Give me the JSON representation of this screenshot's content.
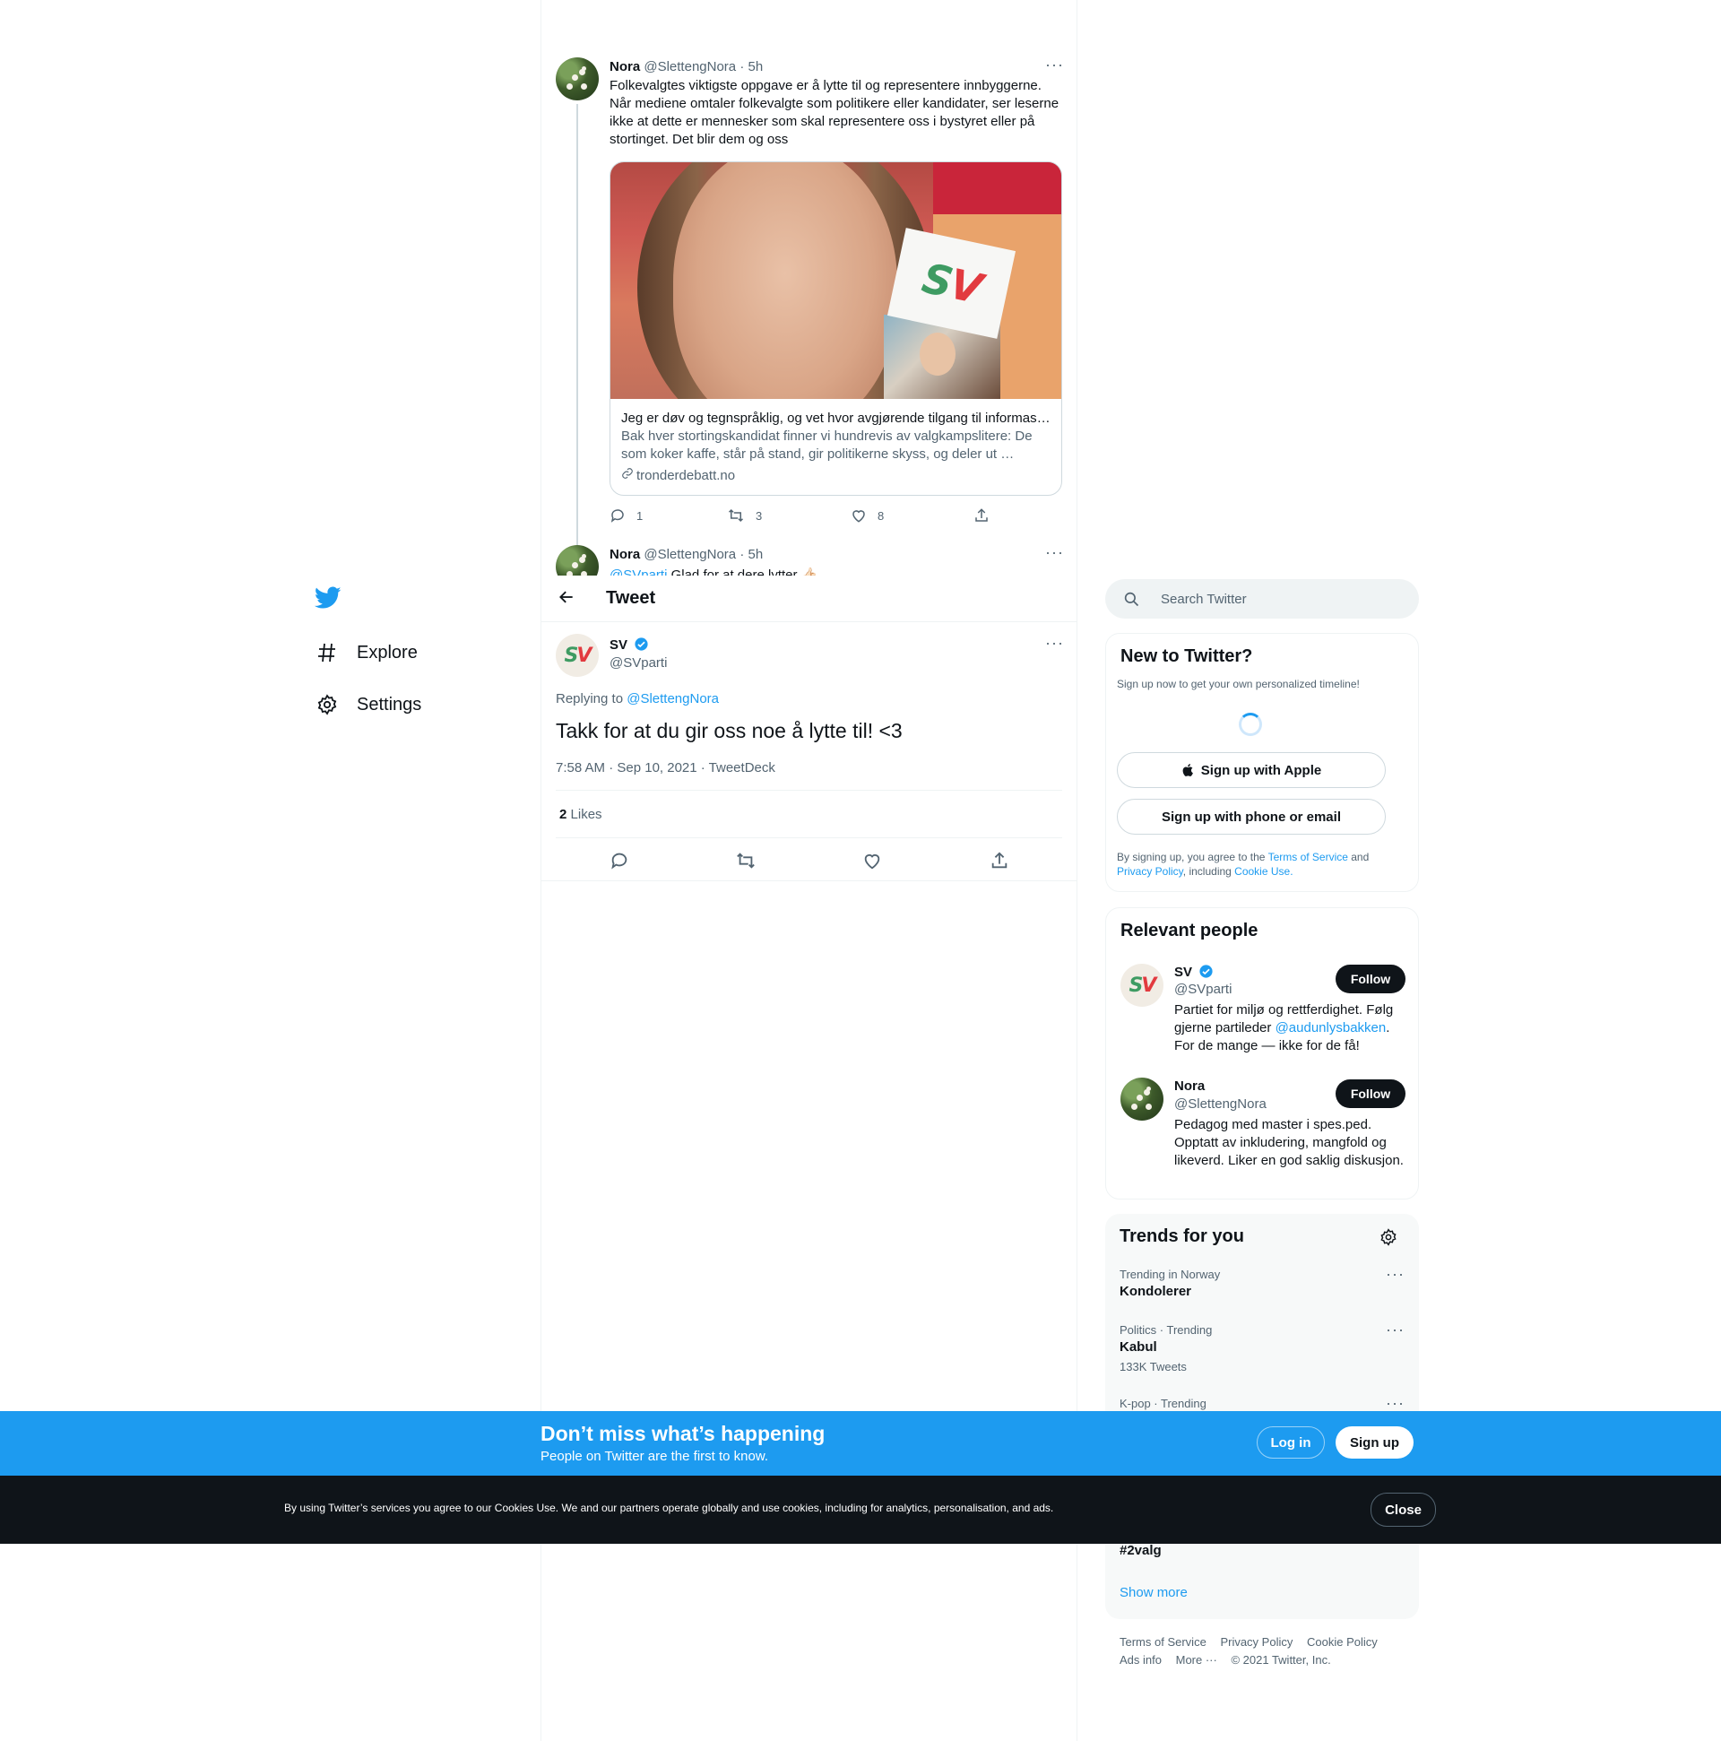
{
  "nav": {
    "explore": "Explore",
    "settings": "Settings"
  },
  "thread": {
    "tweet1": {
      "name": "Nora",
      "handle": "@SlettengNora",
      "sep": "·",
      "time": "5h",
      "text": "Folkevalgtes viktigste oppgave er å lytte til og representere innbyggerne. Når mediene omtaler folkevalgte som politikere eller kandidater, ser leserne ikke at dette er mennesker som skal representere oss i bystyret eller på stortinget. Det blir dem og oss",
      "card": {
        "image_text": "SV",
        "title": "Jeg er døv og tegnspråklig, og vet hvor avgjørende tilgang til informasj…",
        "description": "Bak hver stortingskandidat finner vi hundrevis av valgkampslitere: De som koker kaffe, står på stand, gir politikerne skyss, og deler ut …",
        "domain": "tronderdebatt.no"
      },
      "replies": "1",
      "retweets": "3",
      "likes": "8"
    },
    "tweet2": {
      "name": "Nora",
      "handle": "@SlettengNora",
      "sep": "·",
      "time": "5h",
      "mention": "@SVparti",
      "text": " Glad for at dere lytter 👍🏻"
    }
  },
  "header": {
    "title": "Tweet"
  },
  "main_tweet": {
    "name": "SV",
    "handle": "@SVparti",
    "replying_prefix": "Replying to ",
    "replying_to": "@SlettengNora",
    "text": "Takk for at du gir oss noe å lytte til! <3",
    "timestamp": "7:58 AM · Sep 10, 2021 · ",
    "source": "TweetDeck",
    "likes_count": "2",
    "likes_label": "Likes"
  },
  "sidebar": {
    "search_placeholder": "Search Twitter",
    "new_to_twitter": {
      "title": "New to Twitter?",
      "subtitle": "Sign up now to get your own personalized timeline!",
      "apple_button": "Sign up with Apple",
      "phone_button": "Sign up with phone or email",
      "legal_1": "By signing up, you agree to the ",
      "terms": "Terms of Service",
      "legal_2": " and ",
      "privacy": "Privacy Policy",
      "legal_3": ", including ",
      "cookie": "Cookie Use."
    },
    "relevant_people": {
      "title": "Relevant people",
      "people": [
        {
          "name": "SV",
          "handle": "@SVparti",
          "follow": "Follow",
          "bio_1": "Partiet for miljø og rettferdighet. Følg gjerne partileder ",
          "bio_mention": "@audunlysbakken",
          "bio_2": ". For de mange — ikke for de få!"
        },
        {
          "name": "Nora",
          "handle": "@SlettengNora",
          "follow": "Follow",
          "bio_1": "Pedagog med master i spes.ped. Opptatt av inkludering, mangfold og likeverd. Liker en god saklig diskusjon."
        }
      ]
    },
    "trends": {
      "title": "Trends for you",
      "items": [
        {
          "meta": "Trending in Norway",
          "name": "Kondolerer"
        },
        {
          "meta": "Politics · Trending",
          "name": "Kabul",
          "count": "133K Tweets"
        },
        {
          "meta": "K-pop · Trending"
        },
        {
          "name": "#2valg"
        }
      ],
      "show_more": "Show more"
    },
    "footer": {
      "terms": "Terms of Service",
      "privacy": "Privacy Policy",
      "cookie": "Cookie Policy",
      "ads": "Ads info",
      "more": "More ···",
      "copyright": "© 2021 Twitter, Inc."
    }
  },
  "promo": {
    "title": "Don’t miss what’s happening",
    "subtitle": "People on Twitter are the first to know.",
    "login": "Log in",
    "signup": "Sign up"
  },
  "cookie_bar": {
    "text": "By using Twitter’s services you agree to our Cookies Use. We and our partners operate globally and use cookies, including for analytics, personalisation, and ads.",
    "close": "Close"
  },
  "colors": {
    "accent": "#1d9bf0",
    "text": "#0f1419",
    "muted": "#536471",
    "dark_bar": "#0f1419"
  }
}
